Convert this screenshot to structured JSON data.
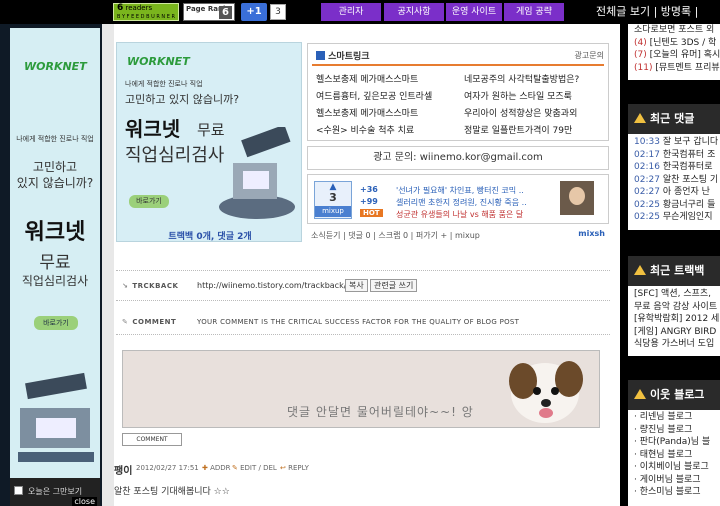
{
  "topbar": {
    "feedburner_count": "6",
    "feedburner_label": "readers",
    "feedburner_sub": "B Y  F E E D B U R N E R",
    "pagerank_label": "Page Rank",
    "pagerank_value": "6",
    "plusone_label": "+1",
    "plusone_count": "3",
    "menus": [
      "관리자",
      "공지사항",
      "운영 사이트",
      "게임 공략"
    ],
    "right_text": "전체글 보기 | 방명록 |"
  },
  "left_ad": {
    "logo": "WORKNET",
    "line1": "나에게 적합한 진로나 직업",
    "line2": "고민하고",
    "line3": "있지 않습니까?",
    "big1": "워크넷",
    "big2": "무료",
    "big3": "직업심리검사",
    "button": "바로가기",
    "dont_show": "오늘은 그만보기",
    "close": "close"
  },
  "main_ad": {
    "logo": "WORKNET",
    "line1": "나에게 적합한 진로나 직업",
    "line2": "고민하고 있지 않습니까?",
    "big1": "워크넷",
    "big1b": "무료",
    "big2": "직업심리검사",
    "button": "바로가기",
    "trackback_text": "트랙백 0개, 댓글 2개"
  },
  "smartlink": {
    "title": "스마트링크",
    "ad_inquiry": "광고문의",
    "links_left": [
      "헬스보충제 메가매스스마트",
      "여드름흉터, 깊은모공 인트라셀",
      "헬스보충제 메가매스스마트",
      "<수원> 비수술 척추 치료"
    ],
    "links_right": [
      "네모공주의 사각턱탈출방법은?",
      "여자가 원하는 스타일 모즈룩",
      "우리아이 성적향상은 맞춤과외",
      "정말로 일플란트가격이 79만"
    ]
  },
  "ad_query": "광고 문의: wiinemo.kor@gmail.com",
  "mixup": {
    "count": "3",
    "label": "mixup",
    "up1": "36",
    "up2": "99",
    "hot": "HOT",
    "lines": [
      "'선녀가 필요해' 차인표, 빵터진 코믹 ..",
      "셀러리맨 초한지 정려원, 진시황 죽음 ..",
      "성균관 유생들의 나날 vs 해품 품은 달"
    ],
    "brand": "mixsh"
  },
  "tags_line": "소식듣기 | 댓글 0 | 스크랩 0 | 퍼가기 +  | mixup",
  "trackback": {
    "label": "TRCKBACK",
    "url": "http://wiinemo.tistory.com/trackback/1130",
    "copy_btn": "복사",
    "write_btn": "관련글 쓰기"
  },
  "comment": {
    "label": "COMMENT",
    "slogan": "YOUR COMMENT IS THE CRITICAL SUCCESS FACTOR FOR THE QUALITY OF BLOG POST",
    "placeholder_text": "댓글 안달면 물어버릴테야~~! 앙",
    "button": "COMMENT"
  },
  "comment_item": {
    "author": "팽이",
    "date": "2012/02/27 17:51",
    "addr": "ADDR",
    "edit": "EDIT / DEL",
    "reply": "REPLY",
    "text": "알찬 포스팅 기대해봅니다 ☆☆"
  },
  "right_top_list": [
    {
      "count": "",
      "text": "소다로보면 포스트 외"
    },
    {
      "count": "(4)",
      "text": "[닌텐도 3DS / 학"
    },
    {
      "count": "(7)",
      "text": "[오늘의 유머] 혹시"
    },
    {
      "count": "(11)",
      "text": "[뮤트멘트 프리뷰"
    }
  ],
  "recent_comments": {
    "title": "최근 댓글",
    "items": [
      {
        "time": "10:33",
        "text": "잘 보구 갑니다"
      },
      {
        "time": "02:17",
        "text": "한국컴퓨터 조"
      },
      {
        "time": "02:16",
        "text": "한국컴퓨터로"
      },
      {
        "time": "02:27",
        "text": "알찬 포스팅 기"
      },
      {
        "time": "02:27",
        "text": "아 종언자 난 "
      },
      {
        "time": "02:25",
        "text": "황금너구리 들"
      },
      {
        "time": "02:25",
        "text": "무슨게임인지"
      }
    ]
  },
  "recent_trackbacks": {
    "title": "최근 트랙백",
    "items": [
      "[SFC] 액션, 스프츠,",
      "무료 음악 감상 사이트",
      "[유학박람회] 2012 세",
      "[게임] ANGRY BIRD",
      "식당용 가스버너 도입"
    ]
  },
  "neighbors": {
    "title": "이웃 블로그",
    "items": [
      "리넨님 블로그",
      "량진님 블로그",
      "판다(Panda)님 블",
      "태현님 블로그",
      "이치베이님 블로그",
      "게이버님 블로그",
      "한스미님 블로그"
    ]
  },
  "colors": {
    "accent_purple": "#7b2fc9",
    "feedburner_green": "#7ab51d",
    "plusone_blue": "#3a6fd8",
    "link_blue": "#3a5da8",
    "hot_orange": "#e87722"
  }
}
